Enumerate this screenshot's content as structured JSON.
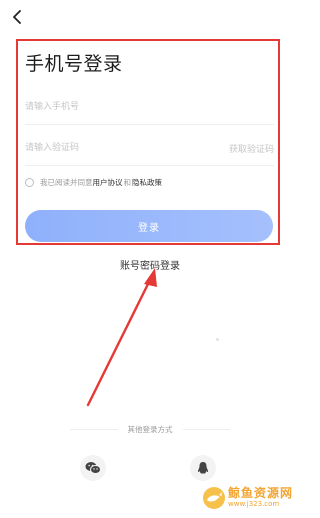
{
  "header": {
    "back_icon": "chevron-left-icon"
  },
  "form": {
    "title": "手机号登录",
    "phone_placeholder": "请输入手机号",
    "code_placeholder": "请输入验证码",
    "get_code_label": "获取验证码",
    "agree_prefix": "我已阅读并同意",
    "user_agreement": "用户协议",
    "and_text": "和",
    "privacy_policy": "隐私政策",
    "login_label": "登录"
  },
  "password_login_label": "账号密码登录",
  "other_login": {
    "label": "其他登录方式",
    "methods": [
      {
        "name": "wechat",
        "icon": "wechat-icon"
      },
      {
        "name": "qq",
        "icon": "qq-icon"
      }
    ]
  },
  "watermark": {
    "text": "鲸鱼资源网",
    "url": "www.j323.com"
  },
  "colors": {
    "accent_button": "#9db8fb",
    "annotation_red": "#e53935",
    "watermark_orange": "#f2a531"
  }
}
